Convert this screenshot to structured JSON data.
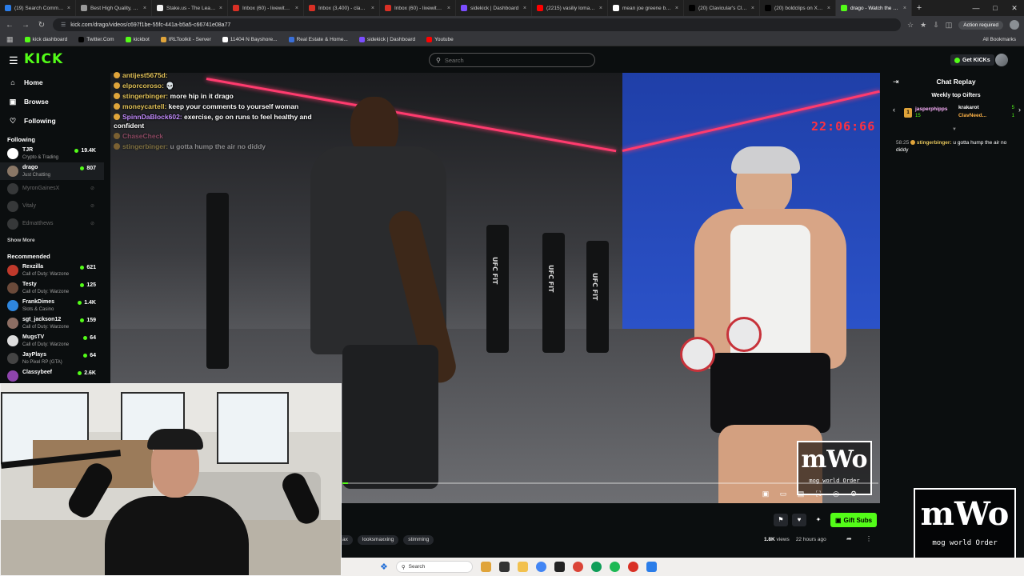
{
  "browser": {
    "tabs": [
      {
        "label": "(19) Search Communit",
        "color": "#2b7de9"
      },
      {
        "label": "Best High Quality, Sof",
        "color": "#999999"
      },
      {
        "label": "Stake.us - The Leading",
        "color": "#f2f2f2"
      },
      {
        "label": "Inbox (60) - livewithcla",
        "color": "#d93025"
      },
      {
        "label": "Inbox (3,400) - clavicul",
        "color": "#d93025"
      },
      {
        "label": "Inbox (60) - livewithcla",
        "color": "#d93025"
      },
      {
        "label": "sidekick | Dashboard",
        "color": "#7b4dff"
      },
      {
        "label": "(2215) vasiliy lomache",
        "color": "#ff0000"
      },
      {
        "label": "mean joe greene bow",
        "color": "#ffffff"
      },
      {
        "label": "(20) Clavicular's Clan C",
        "color": "#000000"
      },
      {
        "label": "(20) boldclips on X: \"C",
        "color": "#000000"
      },
      {
        "label": "drago - Watch the VO",
        "color": "#53fc18"
      }
    ],
    "new_tab": "+",
    "url": "kick.com/drago/videos/c697f1be-55fc-441a-b5a5-c66741e08a77",
    "action_required": "Action required",
    "bookmarks": [
      {
        "label": "kick dashboard",
        "color": "#53fc18"
      },
      {
        "label": "Twitter.Com",
        "color": "#000000"
      },
      {
        "label": "kickbot",
        "color": "#53fc18"
      },
      {
        "label": "IRLToolkit - Server",
        "color": "#e0a43a"
      },
      {
        "label": "11404 N Bayshore...",
        "color": "#ffffff"
      },
      {
        "label": "Real Estate & Home...",
        "color": "#3a6fd8"
      },
      {
        "label": "sidekick | Dashboard",
        "color": "#7b4dff"
      },
      {
        "label": "Youtube",
        "color": "#ff0000"
      }
    ],
    "all_bookmarks": "All Bookmarks"
  },
  "header": {
    "logo": "KICK",
    "search_placeholder": "Search",
    "get_kicks": "Get KICKs"
  },
  "sidebar": {
    "nav": [
      {
        "label": "Home",
        "icon": "house-icon"
      },
      {
        "label": "Browse",
        "icon": "browse-icon"
      },
      {
        "label": "Following",
        "icon": "heart-icon"
      }
    ],
    "following_title": "Following",
    "following": [
      {
        "name": "TJR",
        "category": "Crypto & Trading",
        "viewers": "19.4K",
        "color": "#ffffff",
        "live": true
      },
      {
        "name": "drago",
        "category": "Just Chatting",
        "viewers": "807",
        "color": "#8a7766",
        "live": true
      },
      {
        "name": "MyronGainesX",
        "live": false,
        "color": "#777777"
      },
      {
        "name": "Vitaly",
        "live": false,
        "color": "#777777"
      },
      {
        "name": "Edmatthews",
        "live": false,
        "color": "#777777"
      }
    ],
    "show_more": "Show More",
    "recommended_title": "Recommended",
    "recommended": [
      {
        "name": "Rexzilla",
        "category": "Call of Duty: Warzone",
        "viewers": "621",
        "color": "#c0392b"
      },
      {
        "name": "Testy",
        "category": "Call of Duty: Warzone",
        "viewers": "125",
        "color": "#6b4a3a"
      },
      {
        "name": "FrankDimes",
        "category": "Slots & Casino",
        "viewers": "1.4K",
        "color": "#2e86de"
      },
      {
        "name": "sgt_jackson12",
        "category": "Call of Duty: Warzone",
        "viewers": "159",
        "color": "#8d6e63"
      },
      {
        "name": "MugsTV",
        "category": "Call of Duty: Warzone",
        "viewers": "64",
        "color": "#dddddd"
      },
      {
        "name": "JayPlays",
        "category": "No Pixel RP (GTA)",
        "viewers": "64",
        "color": "#444444"
      },
      {
        "name": "Classybeef",
        "category": "",
        "viewers": "2.6K",
        "color": "#8e44ad"
      }
    ]
  },
  "overlay_chat": [
    {
      "user": "antijest5675d:",
      "text": "",
      "style": ""
    },
    {
      "user": "elporcoroso:",
      "text": "💀",
      "style": ""
    },
    {
      "user": "stingerbinger:",
      "text": "more hip in it drago",
      "style": ""
    },
    {
      "user": "moneycartell:",
      "text": "keep your comments to yourself woman",
      "style": ""
    },
    {
      "user": "SpinnDaBlock602:",
      "text": "exercise, go on runs to feel healthy and confident",
      "style": "purple"
    },
    {
      "user": "ChaseCheck",
      "text": "",
      "style": "pink fade"
    },
    {
      "user": "stingerbinger:",
      "text": "u gotta hump the air no diddy",
      "style": "fade"
    }
  ],
  "video": {
    "clock": "22:06:66",
    "progress": 0.01,
    "controls": [
      {
        "name": "pip-icon",
        "glyph": "▣"
      },
      {
        "name": "theater-icon",
        "glyph": "▭"
      },
      {
        "name": "clip-icon",
        "glyph": "▤"
      },
      {
        "name": "fullscreen-icon",
        "glyph": "⛶"
      },
      {
        "name": "quality-icon",
        "glyph": "◎"
      },
      {
        "name": "settings-icon",
        "glyph": "⚙"
      }
    ]
  },
  "watermark": {
    "big": "mWo",
    "small": "mog world Order"
  },
  "below_video": {
    "tags": [
      "ax",
      "looksmaxxing",
      "stimming"
    ],
    "views": "1.8K",
    "views_label": "views",
    "posted": "22 hours ago",
    "gift_subs": "Gift Subs"
  },
  "chat": {
    "title": "Chat Replay",
    "gifters_title": "Weekly top Gifters",
    "top_gifter": {
      "rank": "1",
      "name": "jasperphipps",
      "count": "15"
    },
    "gifters": [
      {
        "name": "krakarot",
        "count": "5",
        "orange": false
      },
      {
        "name": "ClavNeed...",
        "count": "1",
        "orange": true
      }
    ],
    "message": {
      "time": "58:25",
      "user": "stingerbinger:",
      "text": "u gotta hump the air no diddy"
    }
  },
  "taskbar": {
    "search": "Search"
  }
}
